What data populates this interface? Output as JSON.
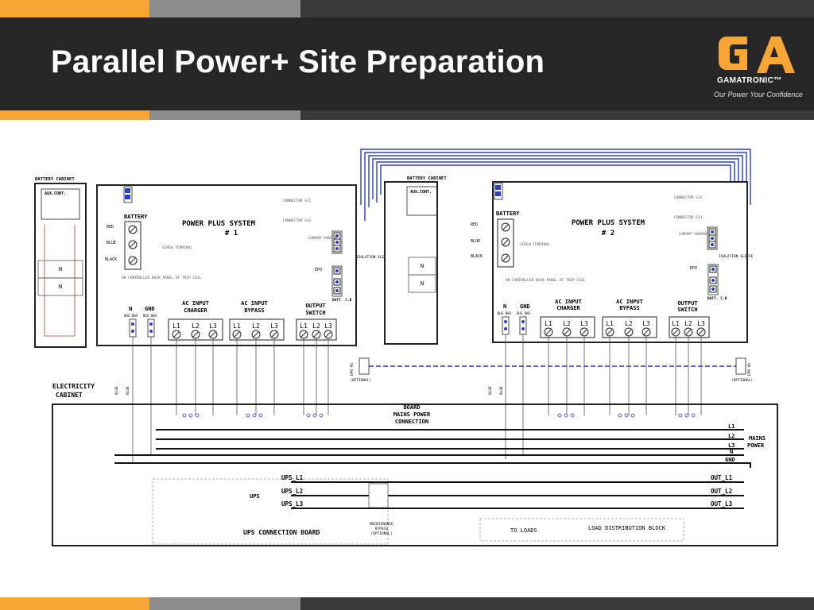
{
  "slide": {
    "title": "Parallel Power+ Site Preparation",
    "colors": {
      "accent": "#f7a534",
      "dark": "#262626",
      "gray": "#8c8c8c",
      "wire_blue": "#2b3fc8"
    }
  },
  "logo": {
    "mark": "GA",
    "brand": "GAMATRONIC™",
    "tagline": "Our Power Your Confidence"
  },
  "diagram": {
    "battery_cabinet": "BATTERY CABINET",
    "aux_cont": "AUX.CONT.",
    "system_1_title": "POWER PLUS SYSTEM",
    "system_1_num": "# 1",
    "system_2_title": "POWER PLUS SYSTEM",
    "system_2_num": "# 2",
    "battery": "BATTERY",
    "screw_terminal": "SCREW TERMINAL",
    "wire_red": "RED",
    "wire_blue": "BLUE",
    "wire_black": "BLACK",
    "connector_s1": "CONNECTOR S11",
    "connector_s2": "CONNECTOR S13",
    "current_sharing": "CURRENT SHARING",
    "epo": "EPO",
    "isolation_sleeve": "ISOLATION SLEEVE",
    "batt_cb": "BATT. C.B",
    "controller_note": "ON CONTROLLER BACK PANEL OF TRIP COIL",
    "n_label": "N",
    "gnd_label": "GND",
    "bus_bar": "BUS BAR",
    "ac_input_charger": [
      "AC INPUT",
      "CHARGER"
    ],
    "ac_input_bypass": [
      "AC INPUT",
      "BYPASS"
    ],
    "output_switch": [
      "OUTPUT",
      "SWITCH"
    ],
    "terminal_labels": [
      "L1",
      "L2",
      "L3"
    ],
    "epo_sw": "EPO #1",
    "optional": "(OPTIONAL)",
    "electricity_cabinet": [
      "ELECTRICITY",
      "CABINET"
    ],
    "board_mains": [
      "BOARD",
      "MAINS POWER",
      "CONNECTION"
    ],
    "mains_lines": [
      "L1",
      "L2",
      "L3",
      "N",
      "GND"
    ],
    "mains_power": [
      "MAINS",
      "POWER"
    ],
    "ups_lines": [
      "UPS_L1",
      "UPS_L2",
      "UPS_L3"
    ],
    "ups_label": "UPS",
    "out_lines": [
      "OUT_L1",
      "OUT_L2",
      "OUT_L3"
    ],
    "ups_connection_board": "UPS CONNECTION BOARD",
    "maintenance_bypass": [
      "MAINTENANCE",
      "BYPASS",
      "(OPTIONAL)"
    ],
    "to_loads": "TO LOADS",
    "load_distribution": "LOAD DISTRIBUTION BLOCK",
    "side_blue": "BLUE",
    "size_label": "1.5mm sq."
  }
}
